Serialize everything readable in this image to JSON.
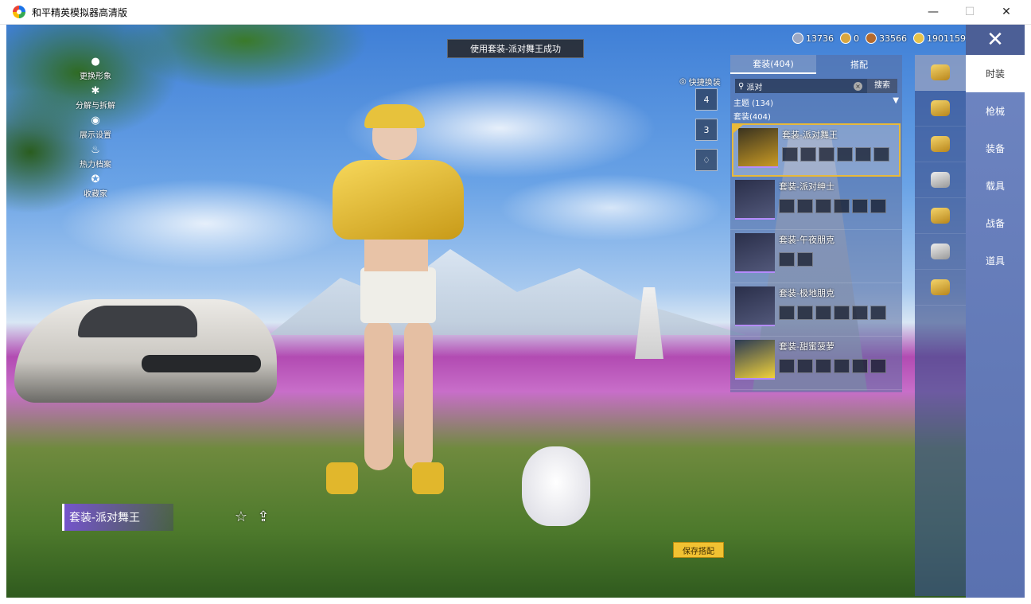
{
  "window": {
    "title": "和平精英模拟器高清版",
    "min_glyph": "—",
    "max_glyph": "☐",
    "close_glyph": "✕"
  },
  "left_menu": [
    {
      "label": "更换形象",
      "icon": "person-icon",
      "glyph": "●"
    },
    {
      "label": "分解与拆解",
      "icon": "gear-icon",
      "glyph": "✱"
    },
    {
      "label": "展示设置",
      "icon": "eye-icon",
      "glyph": "◉"
    },
    {
      "label": "热力档案",
      "icon": "flame-icon",
      "glyph": "♨"
    },
    {
      "label": "收藏家",
      "icon": "medal-icon",
      "glyph": "✪"
    }
  ],
  "toast": "使用套装-派对舞王成功",
  "currencies": [
    {
      "value": "13736",
      "icon": "silver-coin-icon",
      "color": "#9aa7c4"
    },
    {
      "value": "0",
      "icon": "token-icon",
      "color": "#d9a640"
    },
    {
      "value": "33566",
      "icon": "bronze-coin-icon",
      "color": "#b46a2e"
    },
    {
      "value": "1901159",
      "icon": "gold-coin-icon",
      "color": "#e6c24a"
    }
  ],
  "quick_change": {
    "label": "快捷换装",
    "slots": [
      "4",
      "3"
    ]
  },
  "panel": {
    "tabs": [
      "套装(404)",
      "搭配"
    ],
    "search": {
      "value": "派对",
      "button": "搜索",
      "clear": "×",
      "icon_glyph": "⚲"
    },
    "filter": {
      "label": "主题 (134)",
      "arrow": "▼"
    },
    "count": "套装(404)",
    "items": [
      {
        "name": "套装-派对舞王",
        "parts": 6,
        "selected": true
      },
      {
        "name": "套装-派对绅士",
        "parts": 6,
        "selected": false
      },
      {
        "name": "套装-午夜朋克",
        "parts": 2,
        "selected": false
      },
      {
        "name": "套装-极地朋克",
        "parts": 6,
        "selected": false
      },
      {
        "name": "套装-甜蜜菠萝",
        "parts": 6,
        "selected": false
      }
    ]
  },
  "right_nav": {
    "close_glyph": "✕",
    "items": [
      "时装",
      "枪械",
      "装备",
      "载具",
      "战备",
      "道具"
    ]
  },
  "bottom": {
    "outfit_name": "套装-派对舞王",
    "favorite_glyph": "☆",
    "share_glyph": "⇪",
    "save_button": "保存搭配"
  },
  "colors": {
    "accent_gold": "#e8b93a",
    "save_button": "#f1c232",
    "panel_blue": "#5a71b0"
  }
}
